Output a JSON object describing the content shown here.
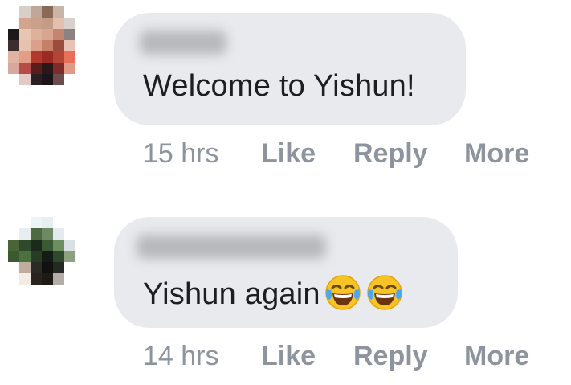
{
  "comments": [
    {
      "author_blurred": true,
      "text": "Welcome to Yishun!",
      "time": "15 hrs",
      "actions": {
        "like": "Like",
        "reply": "Reply",
        "more": "More"
      }
    },
    {
      "author_blurred": true,
      "text": "Yishun again",
      "emojis": [
        "face-with-tears-of-joy-icon",
        "face-with-tears-of-joy-icon"
      ],
      "time": "14 hrs",
      "actions": {
        "like": "Like",
        "reply": "Reply",
        "more": "More"
      }
    }
  ],
  "colors": {
    "bubble": "#e9eaee",
    "text": "#1c1e21",
    "meta": "#8d949e"
  }
}
